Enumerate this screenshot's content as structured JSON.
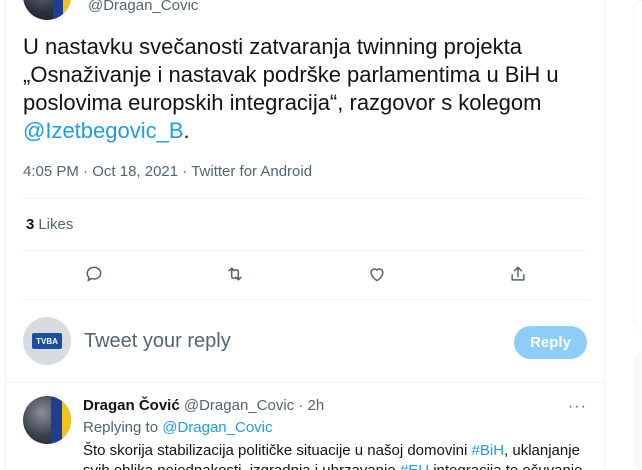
{
  "top": {
    "handle": "@Dragan_Covic"
  },
  "tweet": {
    "text_part1": "U nastavku svečanosti zatvaranja twinning projekta „Osnaživanje i nastavak podrške parlamentima u BiH u poslovima europskih integracija“, razgovor s kolegom ",
    "mention": "@Izetbegovic_B",
    "text_end": ".",
    "time": "4:05 PM",
    "date": "Oct 18, 2021",
    "source": "Twitter for Android",
    "sep": " · "
  },
  "stats": {
    "likes_count": "3",
    "likes_label": "Likes"
  },
  "actions": [
    {
      "icon": "reply-icon"
    },
    {
      "icon": "retweet-icon"
    },
    {
      "icon": "like-icon"
    },
    {
      "icon": "share-icon"
    }
  ],
  "composer": {
    "avatar_label": "TVBA",
    "placeholder": "Tweet your reply",
    "button_label": "Reply"
  },
  "reply": {
    "name": "Dragan Čović",
    "handle": "@Dragan_Covic",
    "time": "2h",
    "sep": " · ",
    "replying_label": "Replying to",
    "replying_mention": "@Dragan_Covic",
    "more": "···",
    "text_part1": "Što skorija stabilizacija političke situacije u našoj domovini ",
    "tag1": "#BiH",
    "text_part2": ", uklanjanje svih oblika nejednakosti, izgradnja i ubrzavanje ",
    "tag2": "#EU",
    "text_part3": " integracija te očuvanje"
  },
  "colors": {
    "accent": "#1d9bf0",
    "muted": "#536471",
    "reply_button_disabled": "#8ecdf8"
  }
}
